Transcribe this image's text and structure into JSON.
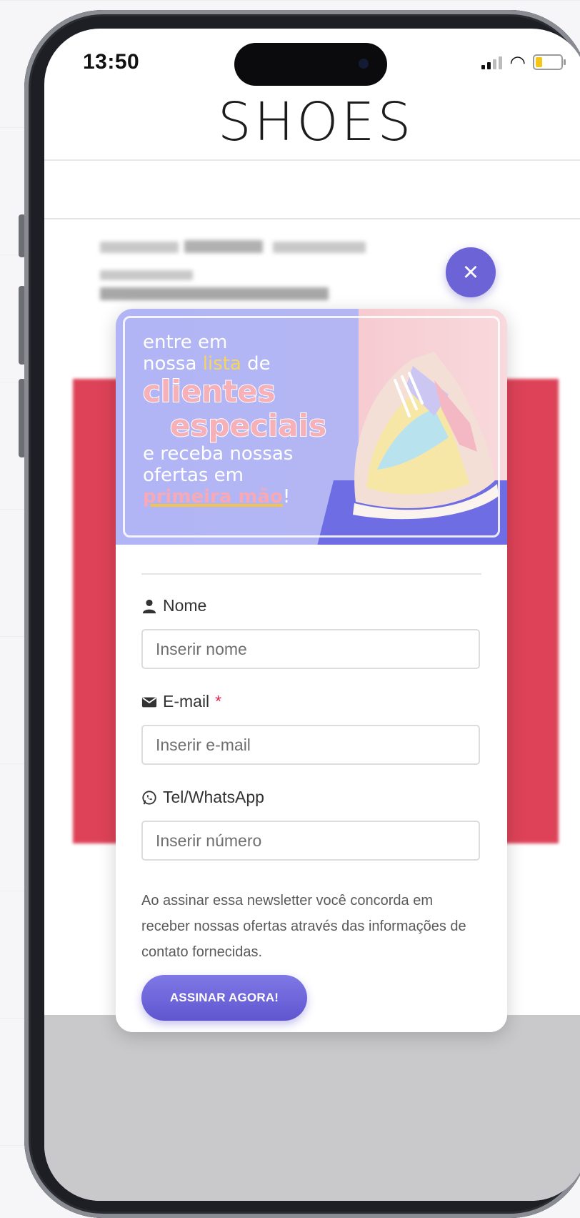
{
  "status_bar": {
    "time": "13:50"
  },
  "store": {
    "logo": "SHOES"
  },
  "popup": {
    "banner": {
      "line1": "entre em",
      "line2_prefix": "nossa ",
      "line2_highlight": "lista",
      "line2_suffix": " de",
      "big1": "clientes",
      "big2": "especiais",
      "line3": "e receba nossas",
      "line4": "ofertas em",
      "line5_highlight": "primeira mão",
      "line5_suffix": "!"
    },
    "name": {
      "label": "Nome",
      "placeholder": "Inserir nome",
      "icon": "user-icon"
    },
    "email": {
      "label": "E-mail",
      "required_mark": "*",
      "placeholder": "Inserir e-mail",
      "icon": "envelope-icon"
    },
    "phone": {
      "label": "Tel/WhatsApp",
      "placeholder": "Inserir número",
      "icon": "whatsapp-icon"
    },
    "legal_text": "Ao assinar essa newsletter você concorda em receber nossas ofertas através das informações de contato fornecidas.",
    "submit_label": "ASSINAR AGORA!",
    "close_label": "×"
  },
  "colors": {
    "accent": "#6b63d6",
    "banner_lavender": "#b2b5f5",
    "banner_pink": "#f6cbd1",
    "background_red": "#d2021f"
  }
}
